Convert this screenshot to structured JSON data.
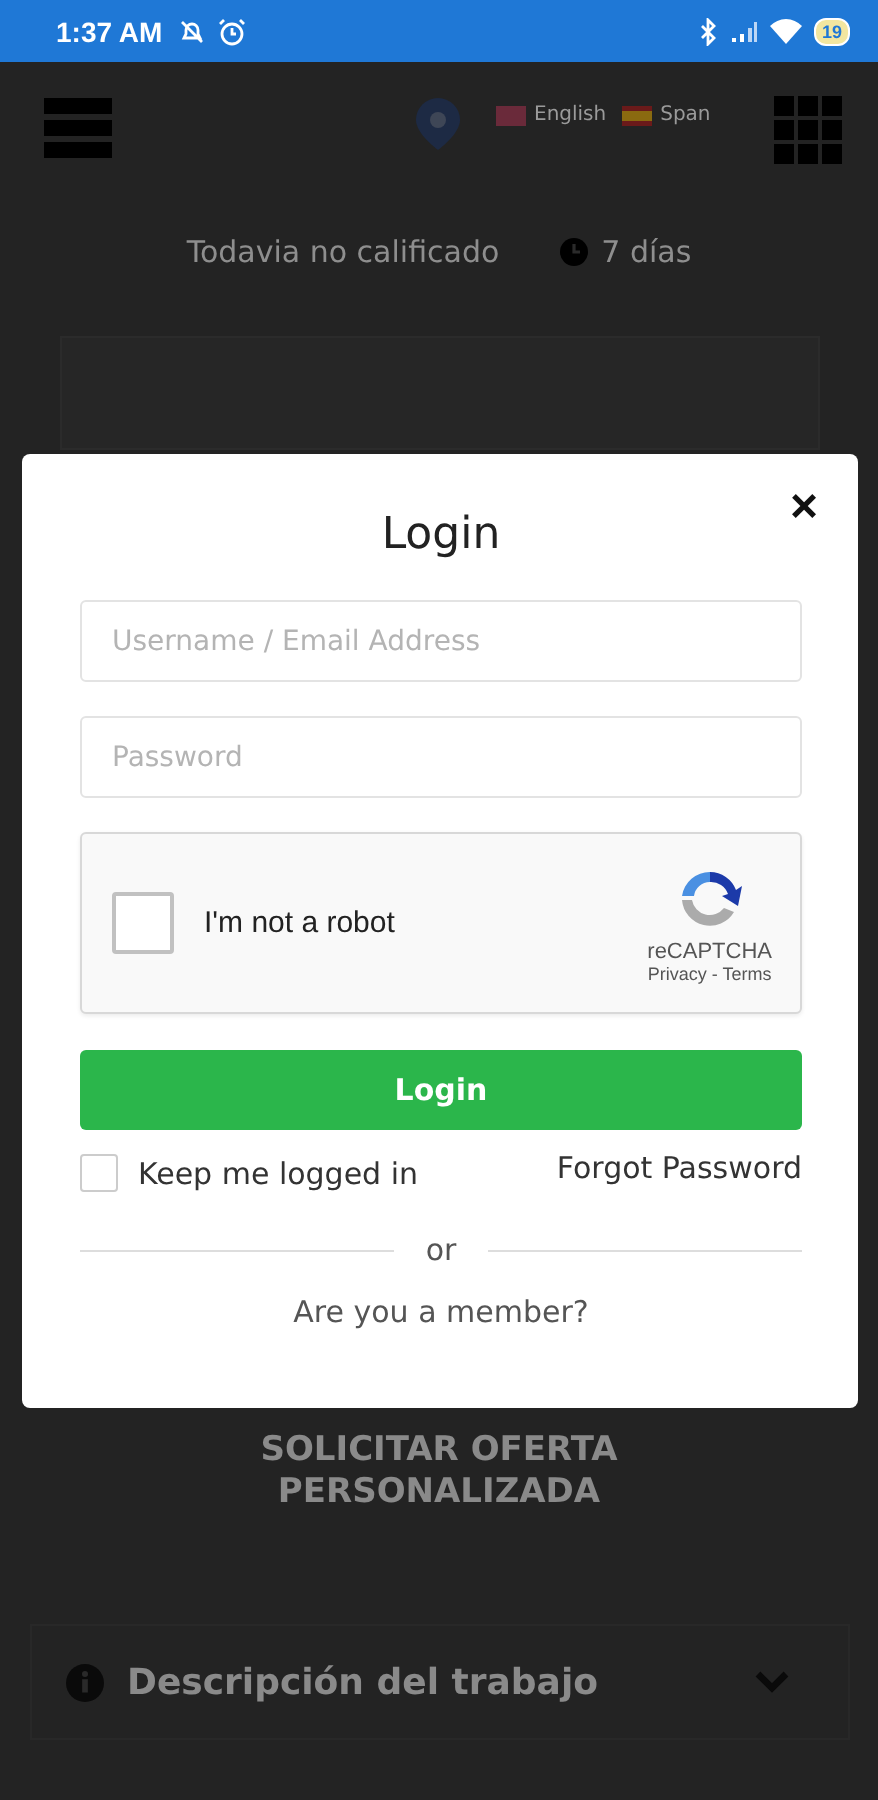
{
  "status_bar": {
    "time": "1:37 AM",
    "battery": "19"
  },
  "header": {
    "languages": [
      {
        "label": "English"
      },
      {
        "label": "Span"
      }
    ]
  },
  "rating": {
    "label": "Todavia no calificado",
    "duration": "7 días"
  },
  "login_modal": {
    "title": "Login",
    "close": "×",
    "username": {
      "placeholder": "Username / Email Address"
    },
    "password": {
      "placeholder": "Password"
    },
    "captcha": {
      "label": "I'm not a robot",
      "checked": false,
      "brand": "reCAPTCHA",
      "links": "Privacy - Terms"
    },
    "login_button": "Login",
    "remember": {
      "label": "Keep me logged in",
      "checked": false
    },
    "forgot": "Forgot Password",
    "divider": "or",
    "member_link": "Are you a member?"
  },
  "offer_button": "SOLICITAR OFERTA PERSONALIZADA",
  "section": {
    "title": "Descripción del trabajo",
    "expanded": false
  }
}
